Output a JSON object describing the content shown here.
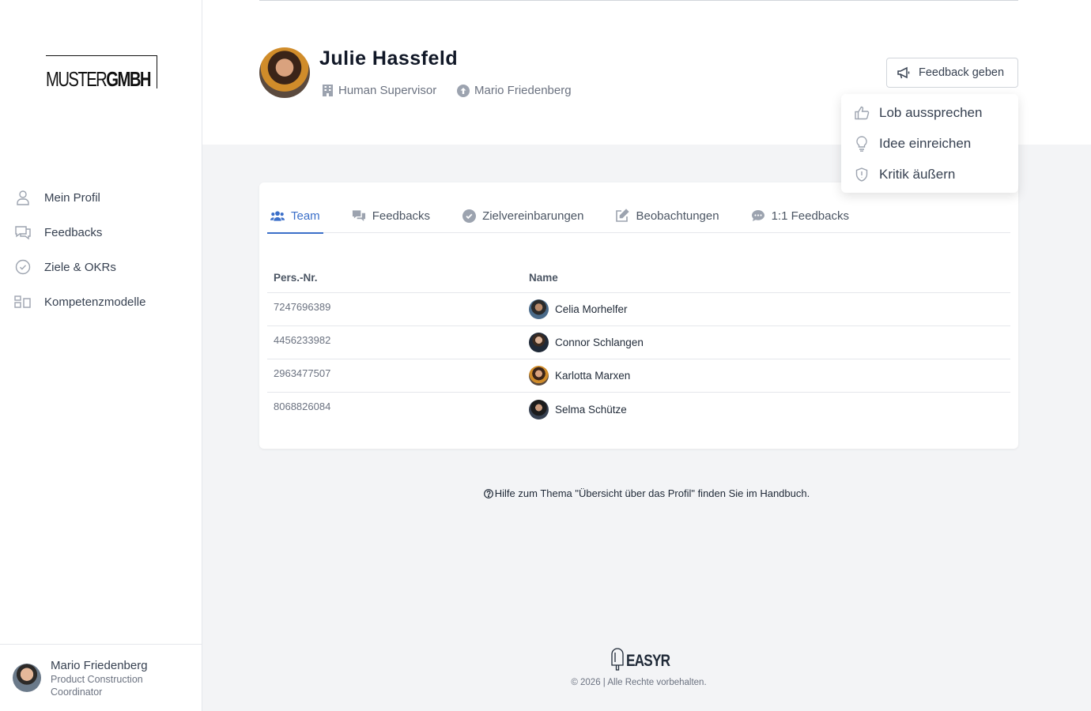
{
  "brand": {
    "logo_regular": "MUSTER",
    "logo_bold": "GMBH"
  },
  "sidebar": {
    "items": [
      {
        "label": "Mein Profil",
        "icon": "user-icon"
      },
      {
        "label": "Feedbacks",
        "icon": "chat-bubbles-icon"
      },
      {
        "label": "Ziele & OKRs",
        "icon": "check-circle-icon"
      },
      {
        "label": "Kompetenzmodelle",
        "icon": "grid-icon"
      }
    ],
    "user": {
      "name": "Mario Friedenberg",
      "role": "Product Construction Coordinator"
    }
  },
  "profile": {
    "name": "Julie Hassfeld",
    "position": "Human Supervisor",
    "manager": "Mario Friedenberg"
  },
  "feedback_button": {
    "label": "Feedback geben"
  },
  "dropdown": {
    "items": [
      {
        "label": "Lob aussprechen",
        "icon": "thumbs-up-icon"
      },
      {
        "label": "Idee einreichen",
        "icon": "lightbulb-icon"
      },
      {
        "label": "Kritik äußern",
        "icon": "shield-icon"
      }
    ]
  },
  "tabs": [
    {
      "label": "Team",
      "active": true
    },
    {
      "label": "Feedbacks",
      "active": false
    },
    {
      "label": "Zielvereinbarungen",
      "active": false
    },
    {
      "label": "Beobachtungen",
      "active": false
    },
    {
      "label": "1:1 Feedbacks",
      "active": false
    }
  ],
  "team_table": {
    "headers": [
      "Pers.-Nr.",
      "Name"
    ],
    "rows": [
      {
        "id": "7247696389",
        "name": "Celia Morhelfer"
      },
      {
        "id": "4456233982",
        "name": "Connor Schlangen"
      },
      {
        "id": "2963477507",
        "name": "Karlotta Marxen"
      },
      {
        "id": "8068826084",
        "name": "Selma Schütze"
      }
    ]
  },
  "help_text": "Hilfe zum Thema \"Übersicht über das Profil\" finden Sie im Handbuch.",
  "footer": {
    "brand": "EASYR",
    "copyright": "© 2026 | Alle Rechte vorbehalten."
  },
  "colors": {
    "accent": "#3b6fc9",
    "background": "#f3f4f6"
  }
}
